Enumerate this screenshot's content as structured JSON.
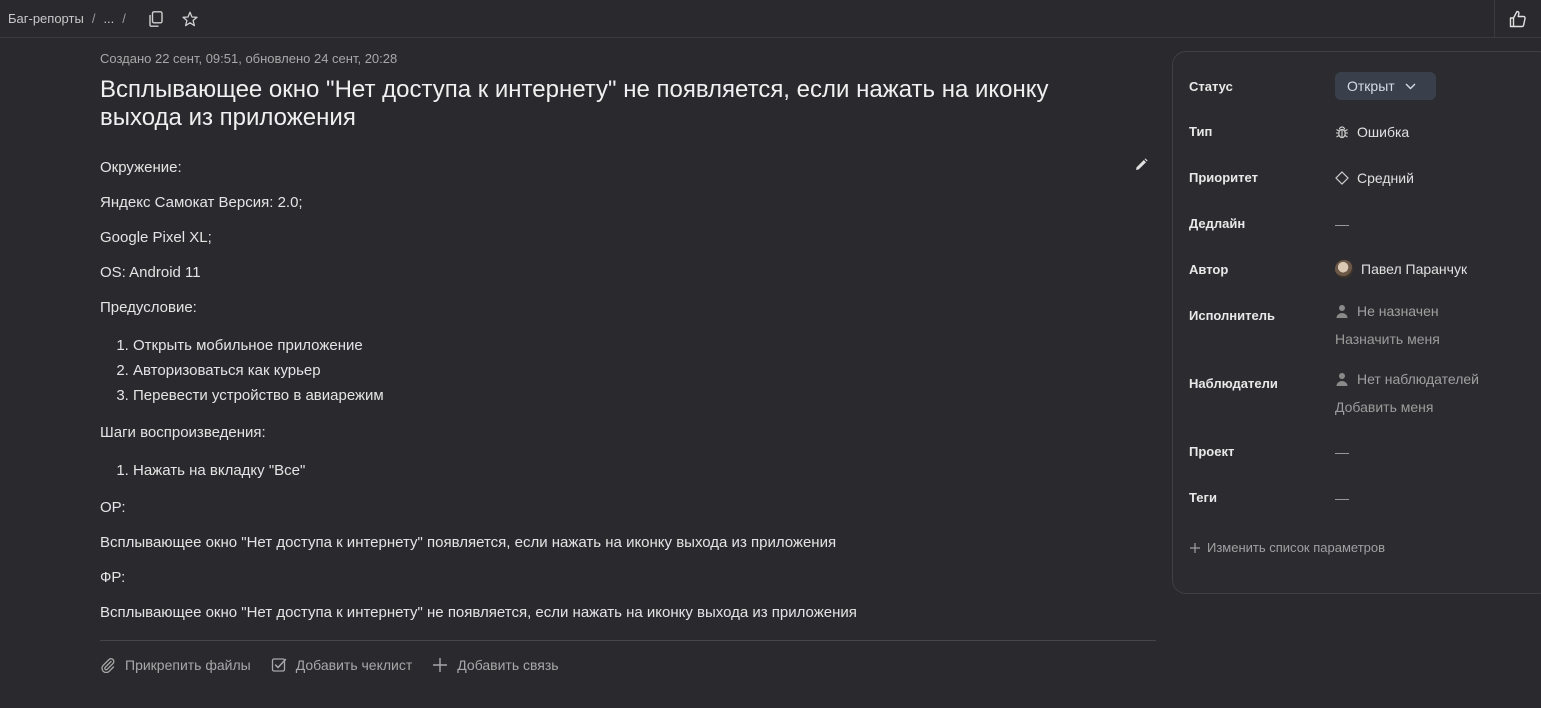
{
  "breadcrumb": {
    "root": "Баг-репорты",
    "separator": "/",
    "ellipsis": "...",
    "trailing_separator": "/"
  },
  "icons": {
    "copy": "copy-icon",
    "star": "star-icon",
    "like": "thumbs-up-icon",
    "edit": "pencil-icon"
  },
  "issue": {
    "meta": "Создано 22 сент, 09:51, обновлено 24 сент, 20:28",
    "title": "Всплывающее окно \"Нет доступа к интернету\" не появляется, если нажать на иконку выхода из приложения",
    "description": {
      "environment_label": "Окружение:",
      "env_lines": [
        "Яндекс Самокат Версия: 2.0;",
        "Google Pixel XL;",
        "OS: Android 11"
      ],
      "precondition_label": "Предусловие:",
      "preconditions": [
        "Открыть мобильное приложение",
        "Авторизоваться как курьер",
        "Перевести устройство в авиарежим"
      ],
      "steps_label": "Шаги воспроизведения:",
      "steps": [
        "Нажать на вкладку \"Все\""
      ],
      "expected_label": "ОР:",
      "expected": "Всплывающее окно \"Нет доступа к интернету\" появляется, если нажать на иконку выхода из приложения",
      "actual_label": "ФР:",
      "actual": "Всплывающее окно \"Нет доступа к интернету\" не появляется, если нажать на иконку выхода из приложения"
    }
  },
  "actions": {
    "attach": "Прикрепить файлы",
    "checklist": "Добавить чеклист",
    "link": "Добавить связь"
  },
  "sidebar": {
    "status": {
      "label": "Статус",
      "value": "Открыт"
    },
    "type": {
      "label": "Тип",
      "value": "Ошибка"
    },
    "priority": {
      "label": "Приоритет",
      "value": "Средний"
    },
    "deadline": {
      "label": "Дедлайн",
      "value": "—"
    },
    "author": {
      "label": "Автор",
      "value": "Павел Паранчук"
    },
    "assignee": {
      "label": "Исполнитель",
      "value": "Не назначен",
      "action": "Назначить меня"
    },
    "followers": {
      "label": "Наблюдатели",
      "value": "Нет наблюдателей",
      "action": "Добавить меня"
    },
    "project": {
      "label": "Проект",
      "value": "—"
    },
    "tags": {
      "label": "Теги",
      "value": "—"
    },
    "edit_params": "Изменить список параметров"
  }
}
